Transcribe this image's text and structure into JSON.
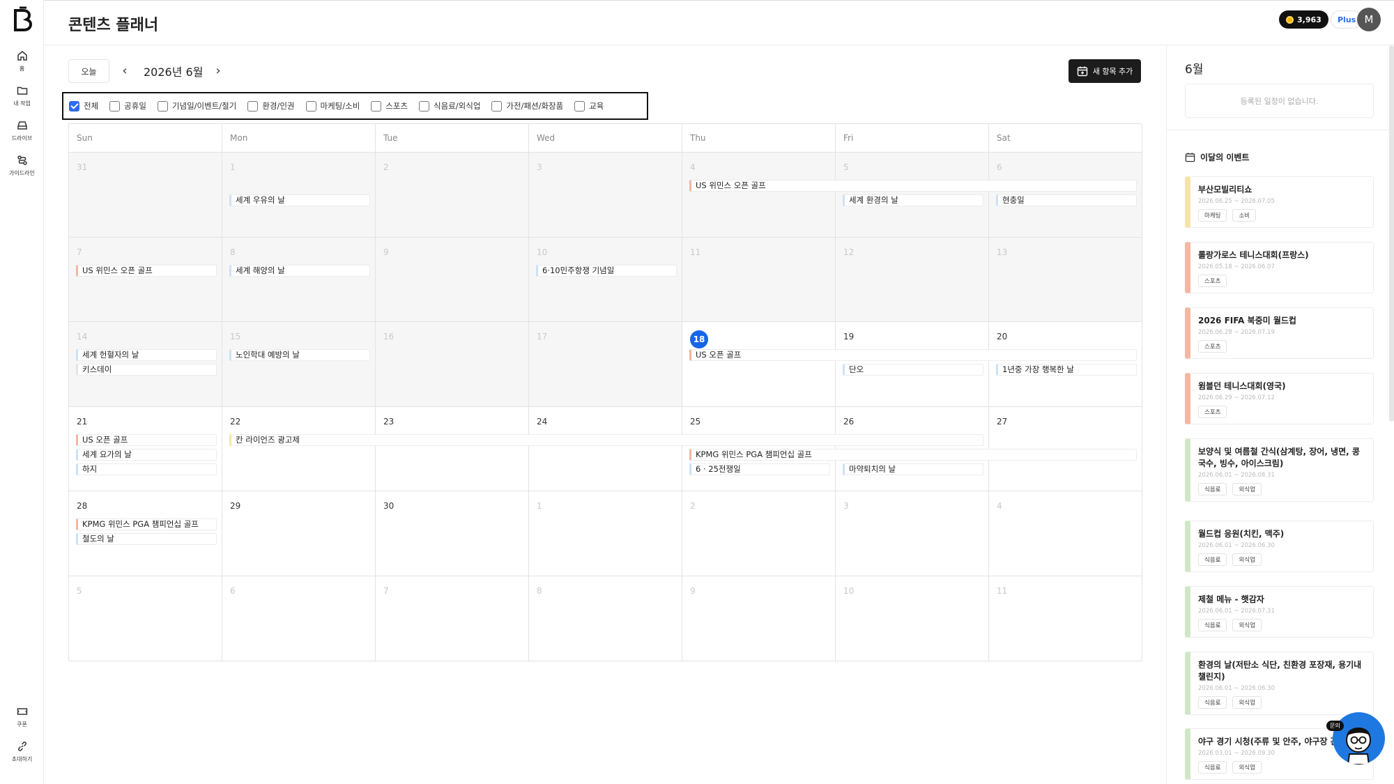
{
  "nav": {
    "items": [
      {
        "label": "홈",
        "icon": "home-icon"
      },
      {
        "label": "내 작업",
        "icon": "folder-icon"
      },
      {
        "label": "드라이브",
        "icon": "drive-icon"
      },
      {
        "label": "가이드라인",
        "icon": "guideline-icon"
      }
    ],
    "bottom": [
      {
        "label": "쿠폰",
        "icon": "coupon-icon"
      },
      {
        "label": "초대하기",
        "icon": "invite-link-icon"
      }
    ]
  },
  "header": {
    "title": "콘텐츠 플래너",
    "credits": "3,963",
    "plan": "Plus",
    "avatar_initial": "M"
  },
  "toolbar": {
    "today_label": "오늘",
    "prev": "‹",
    "next": "›",
    "month_label": "2026년 6월",
    "add_label": "새 항목 추가"
  },
  "filters": [
    {
      "label": "전체",
      "checked": true
    },
    {
      "label": "공휴일",
      "checked": false
    },
    {
      "label": "기념일/이벤트/절기",
      "checked": false
    },
    {
      "label": "환경/인권",
      "checked": false
    },
    {
      "label": "마케팅/소비",
      "checked": false
    },
    {
      "label": "스포츠",
      "checked": false
    },
    {
      "label": "식음료/외식업",
      "checked": false
    },
    {
      "label": "가전/패션/화장품",
      "checked": false
    },
    {
      "label": "교육",
      "checked": false
    }
  ],
  "calendar": {
    "weekdays": [
      "Sun",
      "Mon",
      "Tue",
      "Wed",
      "Thu",
      "Fri",
      "Sat"
    ],
    "weeks": [
      [
        "31",
        "1",
        "2",
        "3",
        "4",
        "5",
        "6"
      ],
      [
        "7",
        "8",
        "9",
        "10",
        "11",
        "12",
        "13"
      ],
      [
        "14",
        "15",
        "16",
        "17",
        "18",
        "19",
        "20"
      ],
      [
        "21",
        "22",
        "23",
        "24",
        "25",
        "26",
        "27"
      ],
      [
        "28",
        "29",
        "30",
        "1",
        "2",
        "3",
        "4"
      ],
      [
        "5",
        "6",
        "7",
        "8",
        "9",
        "10",
        "11"
      ]
    ],
    "today": "18",
    "events": [
      {
        "title": "세계 우유의 날",
        "week": 0,
        "col": 1,
        "span": 1,
        "row": 1,
        "color": "blue"
      },
      {
        "title": "US 위민스 오픈 골프",
        "week": 0,
        "col": 4,
        "span": 3,
        "row": 0,
        "color": "peach"
      },
      {
        "title": "세계 환경의 날",
        "week": 0,
        "col": 5,
        "span": 1,
        "row": 1,
        "color": "blue"
      },
      {
        "title": "현충일",
        "week": 0,
        "col": 6,
        "span": 1,
        "row": 1,
        "color": "blue"
      },
      {
        "title": "US 위민스 오픈 골프",
        "week": 1,
        "col": 0,
        "span": 1,
        "row": 0,
        "color": "peach"
      },
      {
        "title": "세계 해양의 날",
        "week": 1,
        "col": 1,
        "span": 1,
        "row": 0,
        "color": "blue"
      },
      {
        "title": "6·10민주항쟁 기념일",
        "week": 1,
        "col": 3,
        "span": 1,
        "row": 0,
        "color": "blue"
      },
      {
        "title": "세계 헌혈자의 날",
        "week": 2,
        "col": 0,
        "span": 1,
        "row": 0,
        "color": "blue"
      },
      {
        "title": "키스데이",
        "week": 2,
        "col": 0,
        "span": 1,
        "row": 1,
        "color": "plain"
      },
      {
        "title": "노인학대 예방의 날",
        "week": 2,
        "col": 1,
        "span": 1,
        "row": 0,
        "color": "blue"
      },
      {
        "title": "US 오픈 골프",
        "week": 2,
        "col": 4,
        "span": 3,
        "row": 0,
        "color": "peach"
      },
      {
        "title": "단오",
        "week": 2,
        "col": 5,
        "span": 1,
        "row": 1,
        "color": "blue"
      },
      {
        "title": "1년중 가장 행복한 날",
        "week": 2,
        "col": 6,
        "span": 1,
        "row": 1,
        "color": "blue"
      },
      {
        "title": "US 오픈 골프",
        "week": 3,
        "col": 0,
        "span": 1,
        "row": 0,
        "color": "peach"
      },
      {
        "title": "세계 요가의 날",
        "week": 3,
        "col": 0,
        "span": 1,
        "row": 1,
        "color": "blue"
      },
      {
        "title": "하지",
        "week": 3,
        "col": 0,
        "span": 1,
        "row": 2,
        "color": "blue"
      },
      {
        "title": "칸 라이언즈 광고제",
        "week": 3,
        "col": 1,
        "span": 5,
        "row": 0,
        "color": "yellow"
      },
      {
        "title": "KPMG 위민스 PGA 챔피언십 골프",
        "week": 3,
        "col": 4,
        "span": 3,
        "row": 1,
        "color": "peach"
      },
      {
        "title": "6 · 25전쟁일",
        "week": 3,
        "col": 4,
        "span": 1,
        "row": 2,
        "color": "blue"
      },
      {
        "title": "마약퇴치의 날",
        "week": 3,
        "col": 5,
        "span": 1,
        "row": 2,
        "color": "blue"
      },
      {
        "title": "KPMG 위민스 PGA 챔피언십 골프",
        "week": 4,
        "col": 0,
        "span": 1,
        "row": 0,
        "color": "peach"
      },
      {
        "title": "철도의 날",
        "week": 4,
        "col": 0,
        "span": 1,
        "row": 1,
        "color": "blue"
      }
    ]
  },
  "panel": {
    "month": "6월",
    "empty_text": "등록된 일정이 없습니다.",
    "section_title": "이달의 이벤트",
    "cards": [
      {
        "title": "부산모빌리티쇼",
        "date": "2026.06.25 ~ 2026.07.05",
        "tags": [
          "마케팅",
          "소비"
        ],
        "color": "yellow"
      },
      {
        "title": "롤랑가로스 테니스대회(프랑스)",
        "date": "2026.05.18 ~ 2026.06.07",
        "tags": [
          "스포츠"
        ],
        "color": "peach"
      },
      {
        "title": "2026 FIFA 북중미 월드컵",
        "date": "2026.06.28 ~ 2026.07.19",
        "tags": [
          "스포츠"
        ],
        "color": "peach"
      },
      {
        "title": "윔블던 테니스대회(영국)",
        "date": "2026.06.29 ~ 2026.07.12",
        "tags": [
          "스포츠"
        ],
        "color": "peach"
      },
      {
        "title": "보양식 및 여름철 간식(삼계탕, 장어, 냉면, 콩국수, 빙수, 아이스크림)",
        "date": "2026.06.01 ~ 2026.08.31",
        "tags": [
          "식음료",
          "외식업"
        ],
        "color": "green"
      },
      {
        "title": "월드컵 응원(치킨, 맥주)",
        "date": "2026.06.01 ~ 2026.06.30",
        "tags": [
          "식음료",
          "외식업"
        ],
        "color": "green"
      },
      {
        "title": "제철 메뉴 - 햇감자",
        "date": "2026.06.01 ~ 2026.07.31",
        "tags": [
          "식음료",
          "외식업"
        ],
        "color": "green"
      },
      {
        "title": "환경의 날(저탄소 식단, 친환경 포장재, 용기내 챌린지)",
        "date": "2026.06.01 ~ 2026.06.30",
        "tags": [
          "식음료",
          "외식업"
        ],
        "color": "green"
      },
      {
        "title": "야구 경기 시청(주류 및 안주, 야구장 간식)",
        "date": "2026.03.01 ~ 2026.09.30",
        "tags": [
          "식음료",
          "외식업"
        ],
        "color": "green"
      }
    ]
  },
  "chat": {
    "badge": "문의",
    "icon": "support-chat-icon"
  },
  "colors": {
    "accent": "#1565e8",
    "peach": "#f3b7a2",
    "blue": "#cde1f7",
    "yellow": "#f7e3a7",
    "green": "#cfe7c6"
  }
}
